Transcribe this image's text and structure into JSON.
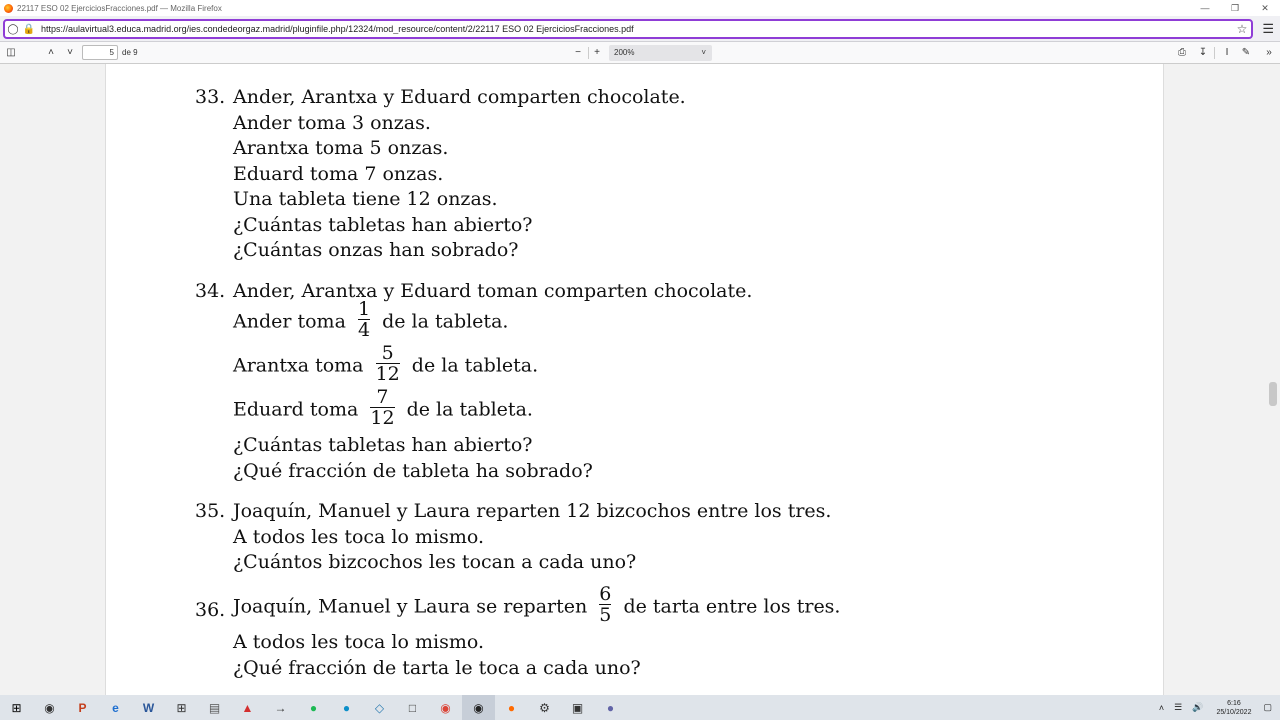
{
  "window": {
    "title": "22117 ESO 02 EjerciciosFracciones.pdf — Mozilla Firefox"
  },
  "urlbar": {
    "url": "https://aulavirtual3.educa.madrid.org/ies.condedeorgaz.madrid/pluginfile.php/12324/mod_resource/content/2/22117 ESO 02 EjerciciosFracciones.pdf"
  },
  "pdf_toolbar": {
    "page_number": "5",
    "page_count": "de 9",
    "zoom": "200%"
  },
  "document": {
    "problems": [
      {
        "number": "33.",
        "lines": [
          "Ander, Arantxa y Eduard comparten chocolate.",
          "Ander toma 3 onzas.",
          "Arantxa toma 5 onzas.",
          "Eduard toma 7 onzas.",
          "Una tableta tiene 12 onzas.",
          "¿Cuántas tabletas han abierto?",
          "¿Cuántas onzas han sobrado?"
        ]
      },
      {
        "number": "34.",
        "first_line": "Ander, Arantxa y Eduard toman comparten chocolate.",
        "fraction_lines": [
          {
            "before": "Ander toma",
            "num": "1",
            "den": "4",
            "after": "de la tableta."
          },
          {
            "before": "Arantxa toma",
            "num": "5",
            "den": "12",
            "after": "de la tableta."
          },
          {
            "before": "Eduard toma",
            "num": "7",
            "den": "12",
            "after": "de la tableta."
          }
        ],
        "lines": [
          "¿Cuántas tabletas han abierto?",
          "¿Qué fracción de tableta ha sobrado?"
        ]
      },
      {
        "number": "35.",
        "lines": [
          "Joaquín, Manuel y Laura reparten 12 bizcochos entre los tres.",
          "A todos les toca lo mismo.",
          "¿Cuántos bizcochos les tocan a cada uno?"
        ]
      },
      {
        "number": "36.",
        "first_line": {
          "before": "Joaquín, Manuel y Laura se reparten",
          "num": "6",
          "den": "5",
          "after": "de tarta entre los tres."
        },
        "lines": [
          "A todos les toca lo mismo.",
          "¿Qué fracción de tarta le toca a cada uno?"
        ]
      }
    ]
  },
  "taskbar": {
    "time": "6:16",
    "date": "25/10/2022",
    "icons": [
      "start-icon",
      "camera-icon",
      "powerpoint-icon",
      "edge-legacy-icon",
      "word-icon",
      "app-icon",
      "calculator-icon",
      "acrobat-icon",
      "snipping-icon",
      "spotify-icon",
      "edge-icon",
      "notes-icon",
      "file-icon",
      "chrome-icon",
      "obs-icon",
      "firefox-icon",
      "gear-icon",
      "screen-icon",
      "teams-icon"
    ]
  }
}
